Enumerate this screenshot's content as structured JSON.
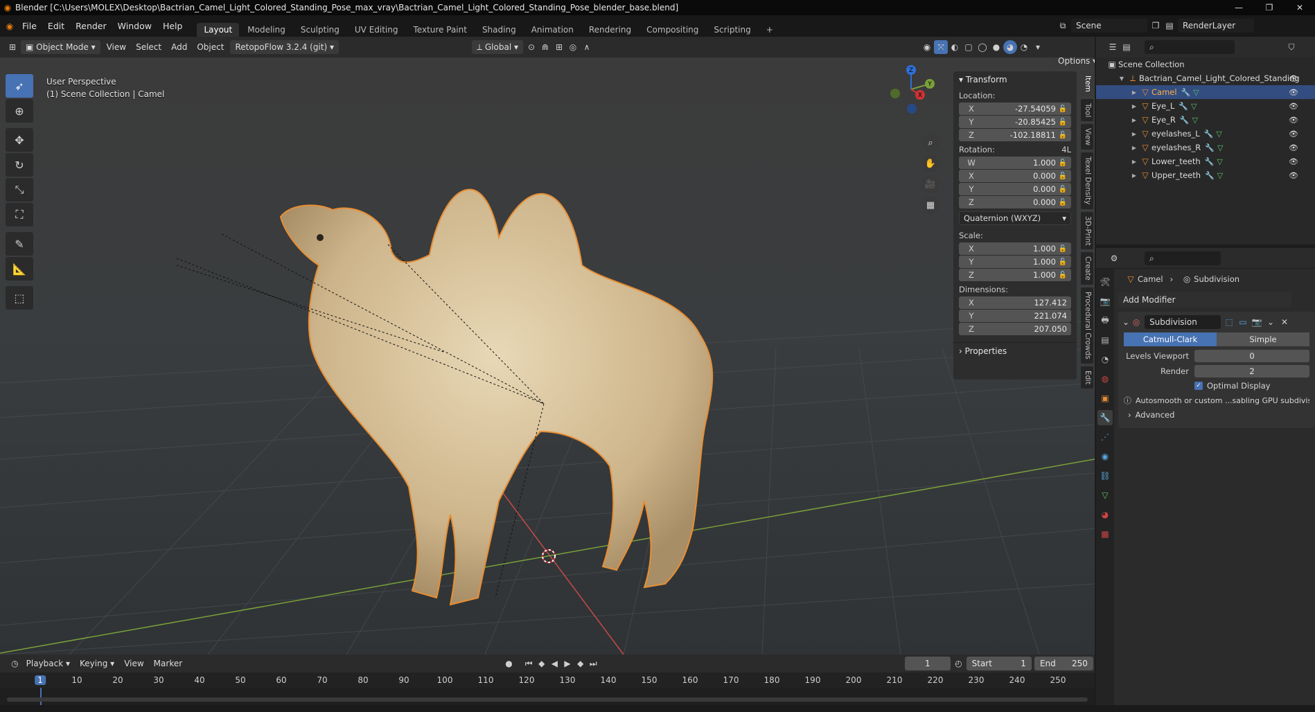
{
  "titlebar": {
    "title": "Blender [C:\\Users\\MOLEX\\Desktop\\Bactrian_Camel_Light_Colored_Standing_Pose_max_vray\\Bactrian_Camel_Light_Colored_Standing_Pose_blender_base.blend]"
  },
  "menu": {
    "file": "File",
    "edit": "Edit",
    "render": "Render",
    "window": "Window",
    "help": "Help"
  },
  "workspaces": [
    {
      "label": "Layout"
    },
    {
      "label": "Modeling"
    },
    {
      "label": "Sculpting"
    },
    {
      "label": "UV Editing"
    },
    {
      "label": "Texture Paint"
    },
    {
      "label": "Shading"
    },
    {
      "label": "Animation"
    },
    {
      "label": "Rendering"
    },
    {
      "label": "Compositing"
    },
    {
      "label": "Scripting"
    }
  ],
  "topright": {
    "scene": "Scene",
    "render_layer": "RenderLayer"
  },
  "viewport_header": {
    "mode": "Object Mode",
    "view": "View",
    "select": "Select",
    "add": "Add",
    "object": "Object",
    "addon": "RetopoFlow 3.2.4 (git)",
    "orientation": "Global",
    "options": "Options"
  },
  "viewport": {
    "perspective": "User Perspective",
    "collection": "(1) Scene Collection | Camel"
  },
  "gizmo": {
    "z": "Z",
    "y": "Y",
    "x": "X"
  },
  "npanel": {
    "transform": "Transform",
    "location": "Location:",
    "loc_x": "-27.54059",
    "loc_y": "-20.85425",
    "loc_z": "-102.18811",
    "rotation": "Rotation:",
    "rot_mode_short": "4L",
    "rot_w": "1.000",
    "rot_x": "0.000",
    "rot_y": "0.000",
    "rot_z": "0.000",
    "rot_mode": "Quaternion (WXYZ)",
    "scale": "Scale:",
    "sc_x": "1.000",
    "sc_y": "1.000",
    "sc_z": "1.000",
    "dimensions": "Dimensions:",
    "dim_x": "127.412",
    "dim_y": "221.074",
    "dim_z": "207.050",
    "properties": "Properties",
    "ax_w": "W",
    "ax_x": "X",
    "ax_y": "Y",
    "ax_z": "Z"
  },
  "ntabs": [
    {
      "label": "Item"
    },
    {
      "label": "Tool"
    },
    {
      "label": "View"
    },
    {
      "label": "Texel Density"
    },
    {
      "label": "3D-Print"
    },
    {
      "label": "Create"
    },
    {
      "label": "Procedural Crowds"
    },
    {
      "label": "Edit"
    }
  ],
  "outliner": {
    "root": "Scene Collection",
    "parent": "Bactrian_Camel_Light_Colored_Standing",
    "items": [
      {
        "name": "Camel"
      },
      {
        "name": "Eye_L"
      },
      {
        "name": "Eye_R"
      },
      {
        "name": "eyelashes_L"
      },
      {
        "name": "eyelashes_R"
      },
      {
        "name": "Lower_teeth"
      },
      {
        "name": "Upper_teeth"
      }
    ]
  },
  "properties": {
    "object": "Camel",
    "modifier_tab": "Subdivision",
    "add_modifier": "Add Modifier",
    "mod_name": "Subdivision",
    "catmull": "Catmull-Clark",
    "simple": "Simple",
    "levels_label": "Levels Viewport",
    "levels_val": "0",
    "render_label": "Render",
    "render_val": "2",
    "optimal": "Optimal Display",
    "warning": "Autosmooth or custom ...sabling GPU subdivision",
    "advanced": "Advanced"
  },
  "timeline": {
    "playback": "Playback",
    "keying": "Keying",
    "view": "View",
    "marker": "Marker",
    "current": "1",
    "start_label": "Start",
    "start": "1",
    "end_label": "End",
    "end": "250",
    "ticks": [
      "1",
      "10",
      "20",
      "30",
      "40",
      "50",
      "60",
      "70",
      "80",
      "90",
      "100",
      "110",
      "120",
      "130",
      "140",
      "150",
      "160",
      "170",
      "180",
      "190",
      "200",
      "210",
      "220",
      "230",
      "240",
      "250"
    ]
  },
  "colors": {
    "accent": "#4772b3",
    "selection_outline": "#e88e34"
  },
  "icons": {
    "blender": "blender-logo-icon",
    "eye": "eye-icon",
    "mesh": "mesh-triangle-icon",
    "wrench": "wrench-icon"
  }
}
